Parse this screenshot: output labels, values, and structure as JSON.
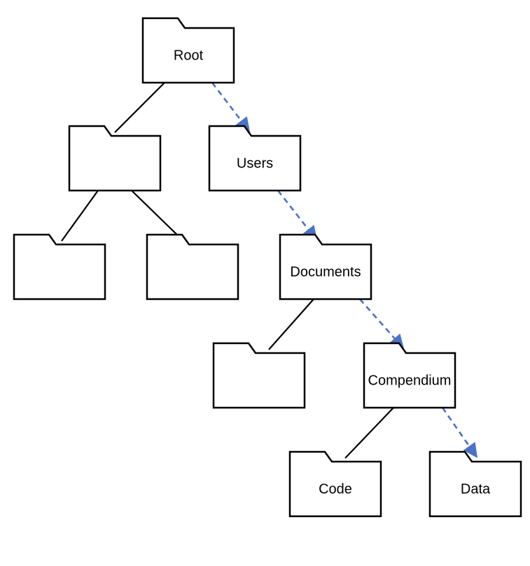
{
  "diagram": {
    "nodes": {
      "root": {
        "label": "Root"
      },
      "l1_left": {
        "label": ""
      },
      "users": {
        "label": "Users"
      },
      "l2_a": {
        "label": ""
      },
      "l2_b": {
        "label": ""
      },
      "documents": {
        "label": "Documents"
      },
      "l3_left": {
        "label": ""
      },
      "compendium": {
        "label": "Compendium"
      },
      "code": {
        "label": "Code"
      },
      "data": {
        "label": "Data"
      }
    },
    "edges": [
      {
        "from": "root",
        "to": "l1_left",
        "style": "solid"
      },
      {
        "from": "root",
        "to": "users",
        "style": "dashed-arrow"
      },
      {
        "from": "l1_left",
        "to": "l2_a",
        "style": "solid"
      },
      {
        "from": "l1_left",
        "to": "l2_b",
        "style": "solid"
      },
      {
        "from": "users",
        "to": "documents",
        "style": "dashed-arrow"
      },
      {
        "from": "documents",
        "to": "l3_left",
        "style": "solid"
      },
      {
        "from": "documents",
        "to": "compendium",
        "style": "dashed-arrow"
      },
      {
        "from": "compendium",
        "to": "code",
        "style": "solid"
      },
      {
        "from": "compendium",
        "to": "data",
        "style": "dashed-arrow"
      }
    ]
  }
}
